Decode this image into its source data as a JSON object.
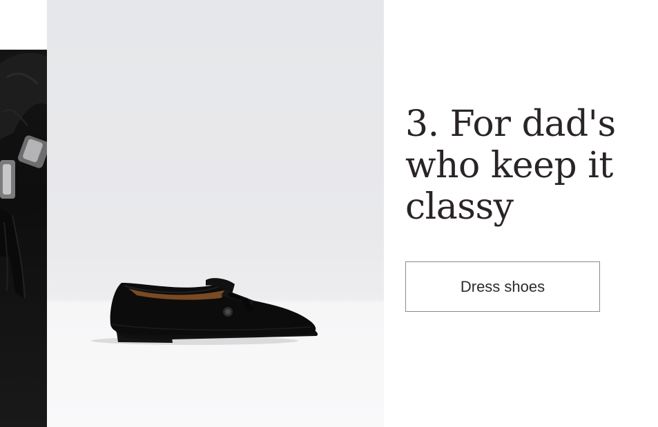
{
  "promo": {
    "heading": "3. For dad's who keep it classy",
    "button_label": "Dress shoes"
  },
  "images": {
    "closeup": "tassel-loafer-closeup-image",
    "product": "black-suede-tassel-loafer-image"
  },
  "colors": {
    "heading_text": "#2a2426",
    "button_border": "#8a8a8a",
    "backdrop": "#e8e9ec"
  }
}
